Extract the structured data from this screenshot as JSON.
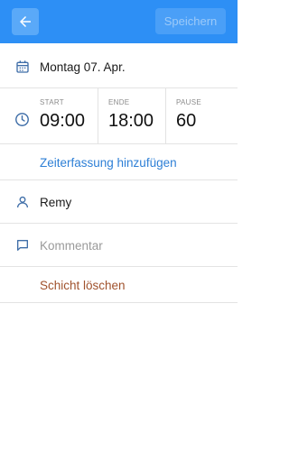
{
  "header": {
    "save_label": "Speichern",
    "back_icon": "arrow-left-icon"
  },
  "date_row": {
    "icon": "calendar-icon",
    "label": "Montag 07. Apr."
  },
  "time_row": {
    "icon": "clock-icon",
    "start": {
      "label": "START",
      "value": "09:00"
    },
    "end": {
      "label": "ENDE",
      "value": "18:00"
    },
    "pause": {
      "label": "PAUSE",
      "value": "60"
    }
  },
  "add_time_entry": {
    "label": "Zeiterfassung hinzufügen"
  },
  "employee_row": {
    "icon": "user-icon",
    "label": "Remy"
  },
  "comment_row": {
    "icon": "comment-icon",
    "placeholder": "Kommentar"
  },
  "delete_shift": {
    "label": "Schicht löschen"
  },
  "colors": {
    "primary": "#2d8ff5",
    "link": "#2d7fd6",
    "danger": "#a0522d"
  }
}
